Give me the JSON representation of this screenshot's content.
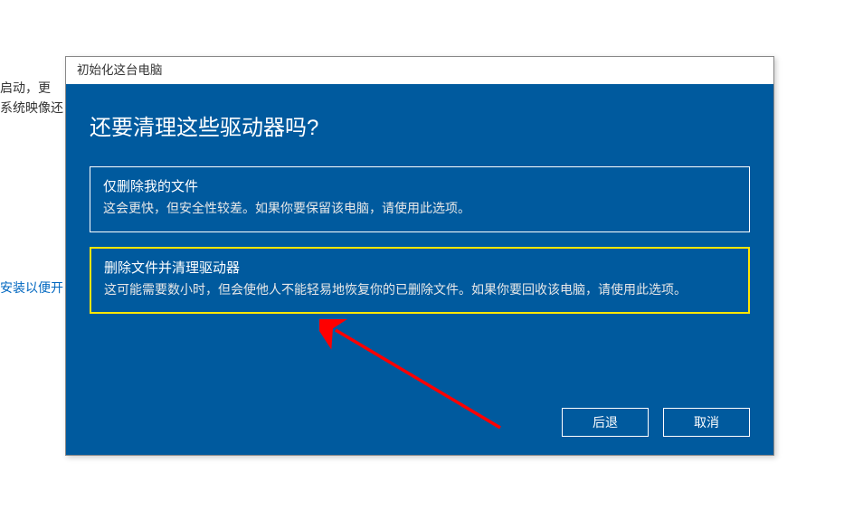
{
  "background": {
    "line1": "启动，更",
    "line2": "系统映像还",
    "link": "安装以便开"
  },
  "dialog": {
    "title": "初始化这台电脑",
    "heading": "还要清理这些驱动器吗?",
    "option1": {
      "title": "仅删除我的文件",
      "desc": "这会更快，但安全性较差。如果你要保留该电脑，请使用此选项。"
    },
    "option2": {
      "title": "删除文件并清理驱动器",
      "desc": "这可能需要数小时，但会使他人不能轻易地恢复你的已删除文件。如果你要回收该电脑，请使用此选项。"
    },
    "buttons": {
      "back": "后退",
      "cancel": "取消"
    }
  }
}
